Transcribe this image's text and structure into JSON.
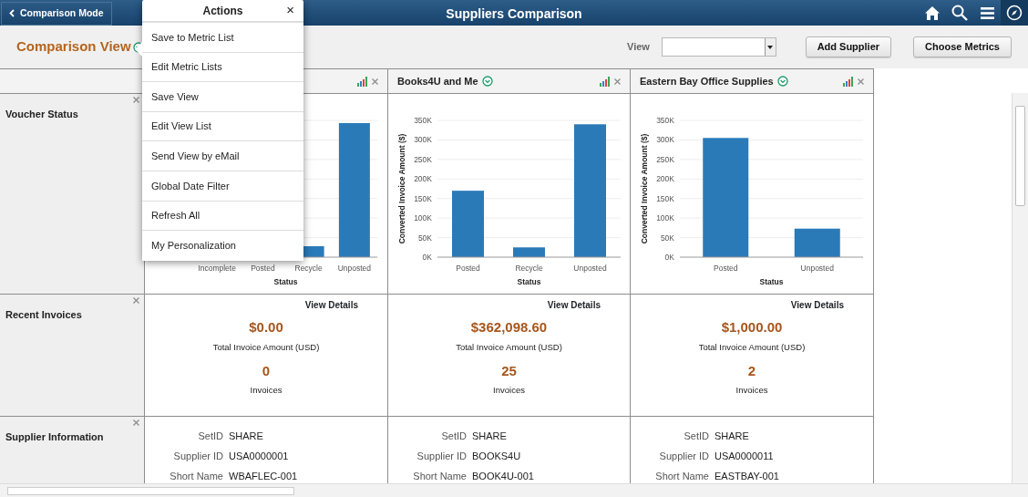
{
  "header": {
    "back_button": "Comparison Mode",
    "title": "Suppliers Comparison"
  },
  "page_title": "Comparison View",
  "view_field": {
    "label": "View"
  },
  "buttons": [
    "Add Supplier",
    "Choose Metrics"
  ],
  "metrics": [
    "Voucher Status",
    "Recent Invoices",
    "Supplier Information"
  ],
  "suppliers": [
    {
      "chart_data": {
        "type": "bar",
        "xlabel": "Status",
        "categories": [
          "Incomplete",
          "Posted",
          "Recycle",
          "Unposted"
        ],
        "ylim": [
          0,
          350000
        ],
        "grid": true,
        "series": [
          {
            "color": "#2a7ab8",
            "values": [
              null,
              null,
              28000,
              343000
            ]
          }
        ]
      },
      "details_link": "View Details",
      "total_amount": "$0.00",
      "total_label": "Total Invoice Amount (USD)",
      "invoice_count": "0",
      "count_label": "Invoices",
      "info": [
        {
          "label": "SetID",
          "value": "SHARE"
        },
        {
          "label": "Supplier ID",
          "value": "USA0000001"
        },
        {
          "label": "Short Name",
          "value": "WBAFLEC-001"
        }
      ]
    },
    {
      "name": "Books4U and Me",
      "chart_data": {
        "type": "bar",
        "xlabel": "Status",
        "ylabel": "Converted Invoice Amount ($)",
        "categories": [
          "Posted",
          "Recycle",
          "Unposted"
        ],
        "ylim": [
          0,
          350000
        ],
        "yticks": [
          {
            "value": 0,
            "label": "0K"
          },
          {
            "value": 50000,
            "label": "50K"
          },
          {
            "value": 100000,
            "label": "100K"
          },
          {
            "value": 150000,
            "label": "150K"
          },
          {
            "value": 200000,
            "label": "200K"
          },
          {
            "value": 250000,
            "label": "250K"
          },
          {
            "value": 300000,
            "label": "300K"
          },
          {
            "value": 350000,
            "label": "350K"
          }
        ],
        "grid": true,
        "series": [
          {
            "color": "#2a7ab8",
            "values": [
              170000,
              25000,
              340000
            ]
          }
        ]
      },
      "details_link": "View Details",
      "total_amount": "$362,098.60",
      "total_label": "Total Invoice Amount (USD)",
      "invoice_count": "25",
      "count_label": "Invoices",
      "info": [
        {
          "label": "SetID",
          "value": "SHARE"
        },
        {
          "label": "Supplier ID",
          "value": "BOOKS4U"
        },
        {
          "label": "Short Name",
          "value": "BOOK4U-001"
        }
      ]
    },
    {
      "name": "Eastern Bay Office Supplies",
      "chart_data": {
        "type": "bar",
        "xlabel": "Status",
        "ylabel": "Converted Invoice Amount ($)",
        "categories": [
          "Posted",
          "Unposted"
        ],
        "ylim": [
          0,
          350000
        ],
        "yticks": [
          {
            "value": 0,
            "label": "0K"
          },
          {
            "value": 50000,
            "label": "50K"
          },
          {
            "value": 100000,
            "label": "100K"
          },
          {
            "value": 150000,
            "label": "150K"
          },
          {
            "value": 200000,
            "label": "200K"
          },
          {
            "value": 250000,
            "label": "250K"
          },
          {
            "value": 300000,
            "label": "300K"
          },
          {
            "value": 350000,
            "label": "350K"
          }
        ],
        "grid": true,
        "series": [
          {
            "color": "#2a7ab8",
            "values": [
              305000,
              73000
            ]
          }
        ]
      },
      "details_link": "View Details",
      "total_amount": "$1,000.00",
      "total_label": "Total Invoice Amount (USD)",
      "invoice_count": "2",
      "count_label": "Invoices",
      "info": [
        {
          "label": "SetID",
          "value": "SHARE"
        },
        {
          "label": "Supplier ID",
          "value": "USA0000011"
        },
        {
          "label": "Short Name",
          "value": "EASTBAY-001"
        }
      ]
    }
  ],
  "actions_menu": {
    "title": "Actions",
    "close": "×",
    "items": [
      "Save to Metric List",
      "Edit Metric Lists",
      "Save View",
      "Edit View List",
      "Send View by eMail",
      "Global Date Filter",
      "Refresh All",
      "My Personalization"
    ]
  }
}
